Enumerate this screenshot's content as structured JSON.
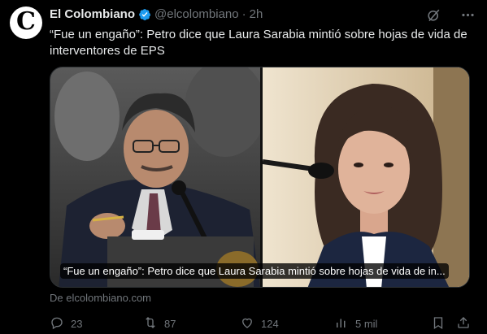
{
  "author": {
    "avatar_letter": "C",
    "name": "El Colombiano",
    "handle": "@elcolombiano",
    "separator": "·",
    "time": "2h"
  },
  "icons": {
    "verified": "verified-badge-icon",
    "grok": "grok-icon",
    "more": "more-options-icon",
    "reply": "reply-icon",
    "retweet": "retweet-icon",
    "like": "like-icon",
    "views": "views-icon",
    "bookmark": "bookmark-icon",
    "share": "share-icon"
  },
  "colors": {
    "background": "#000000",
    "text": "#e7e9ea",
    "muted": "#71767b",
    "verified": "#1d9bf0"
  },
  "tweet": {
    "text": "“Fue un engaño”: Petro dice que Laura Sarabia mintió sobre hojas de vida de interventores de EPS"
  },
  "card": {
    "caption": "“Fue un engaño”: Petro dice que Laura Sarabia mintió sobre hojas de vida de in...",
    "source": "De elcolombiano.com"
  },
  "actions": {
    "replies": "23",
    "retweets": "87",
    "likes": "124",
    "views": "5 mil"
  }
}
